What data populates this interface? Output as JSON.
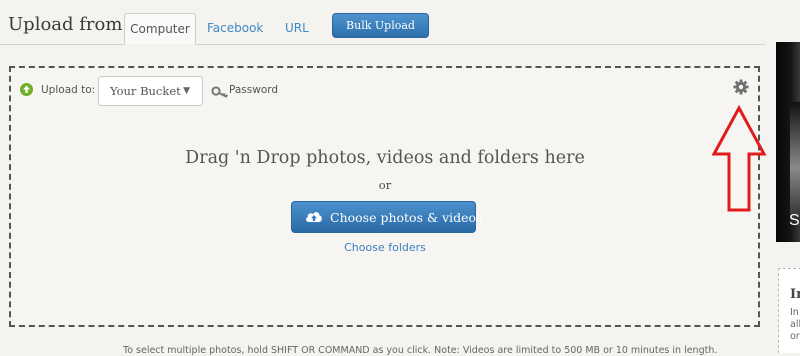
{
  "header": {
    "title": "Upload from:",
    "tabs": [
      {
        "label": "Computer",
        "active": true
      },
      {
        "label": "Facebook",
        "active": false
      },
      {
        "label": "URL",
        "active": false
      }
    ],
    "bulk_upload_label": "Bulk Upload"
  },
  "upload_controls": {
    "upload_to_label": "Upload to:",
    "bucket_value": "Your Bucket",
    "password_label": "Password"
  },
  "drop_zone": {
    "title": "Drag 'n Drop photos, videos and folders here",
    "or_text": "or",
    "choose_button_label": "Choose photos & videos",
    "choose_folders_label": "Choose folders"
  },
  "footnote": "To select multiple photos, hold SHIFT OR COMMAND as you click. Note: Videos are limited to 500 MB or 10 minutes in length.",
  "sidebar": {
    "promo_text": "S",
    "info_title": "In",
    "info_lines": [
      "In",
      "all",
      "or"
    ]
  },
  "colors": {
    "accent_blue": "#3f8ac6",
    "upload_green": "#6fb027",
    "annotation_red": "#e11b1b"
  },
  "icons": {
    "upload": "upload-arrow-icon",
    "key": "key-icon",
    "settings": "gear-icon",
    "cloud": "cloud-upload-icon",
    "chevron": "chevron-down-icon"
  }
}
